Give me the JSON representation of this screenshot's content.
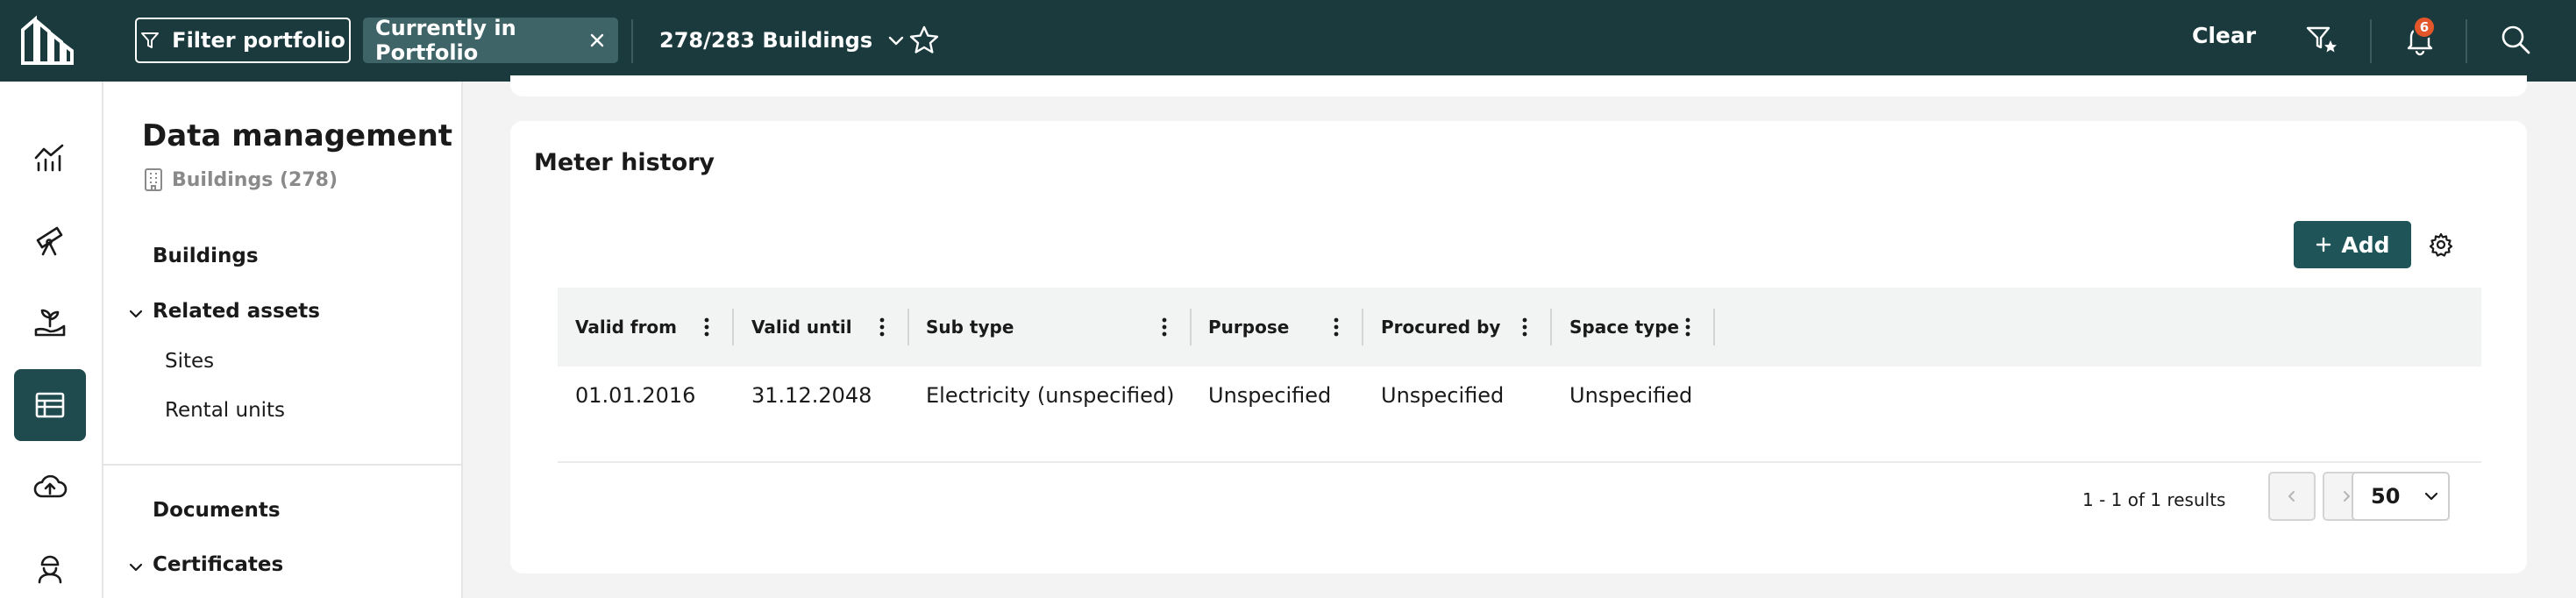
{
  "topbar": {
    "filter_label": "Filter portfolio",
    "chip_label": "Currently in Portfolio",
    "buildings_label": "278/283 Buildings",
    "clear_label": "Clear",
    "notification_count": "6",
    "background_color": "#1b3a3d",
    "icons": [
      "logo-icon",
      "filter-icon",
      "close-icon",
      "chevron-down-icon",
      "star-icon",
      "filter-star-icon",
      "bell-icon",
      "search-icon"
    ]
  },
  "rail": {
    "items": [
      {
        "icon": "chart-icon",
        "active": false
      },
      {
        "icon": "telescope-icon",
        "active": false
      },
      {
        "icon": "plant-hand-icon",
        "active": false
      },
      {
        "icon": "table-icon",
        "active": true
      },
      {
        "icon": "cloud-upload-icon",
        "active": false
      },
      {
        "icon": "worker-icon",
        "active": false
      }
    ],
    "active_color": "#1f4a4e"
  },
  "subnav": {
    "title": "Data management",
    "subtitle": "Buildings (278)",
    "buildings": "Buildings",
    "related_assets": "Related assets",
    "sites": "Sites",
    "rental_units": "Rental units",
    "documents": "Documents",
    "certificates": "Certificates"
  },
  "main": {
    "title": "Meter history",
    "add_label": "Add",
    "add_color": "#1f5559",
    "columns": [
      "Valid from",
      "Valid until",
      "Sub type",
      "Purpose",
      "Procured by",
      "Space type"
    ],
    "rows": [
      [
        "01.01.2016",
        "31.12.2048",
        "Electricity (unspecified)",
        "Unspecified",
        "Unspecified",
        "Unspecified"
      ]
    ],
    "pagination": {
      "summary": "1 -  1 of  1 results",
      "per_page": "50"
    }
  }
}
